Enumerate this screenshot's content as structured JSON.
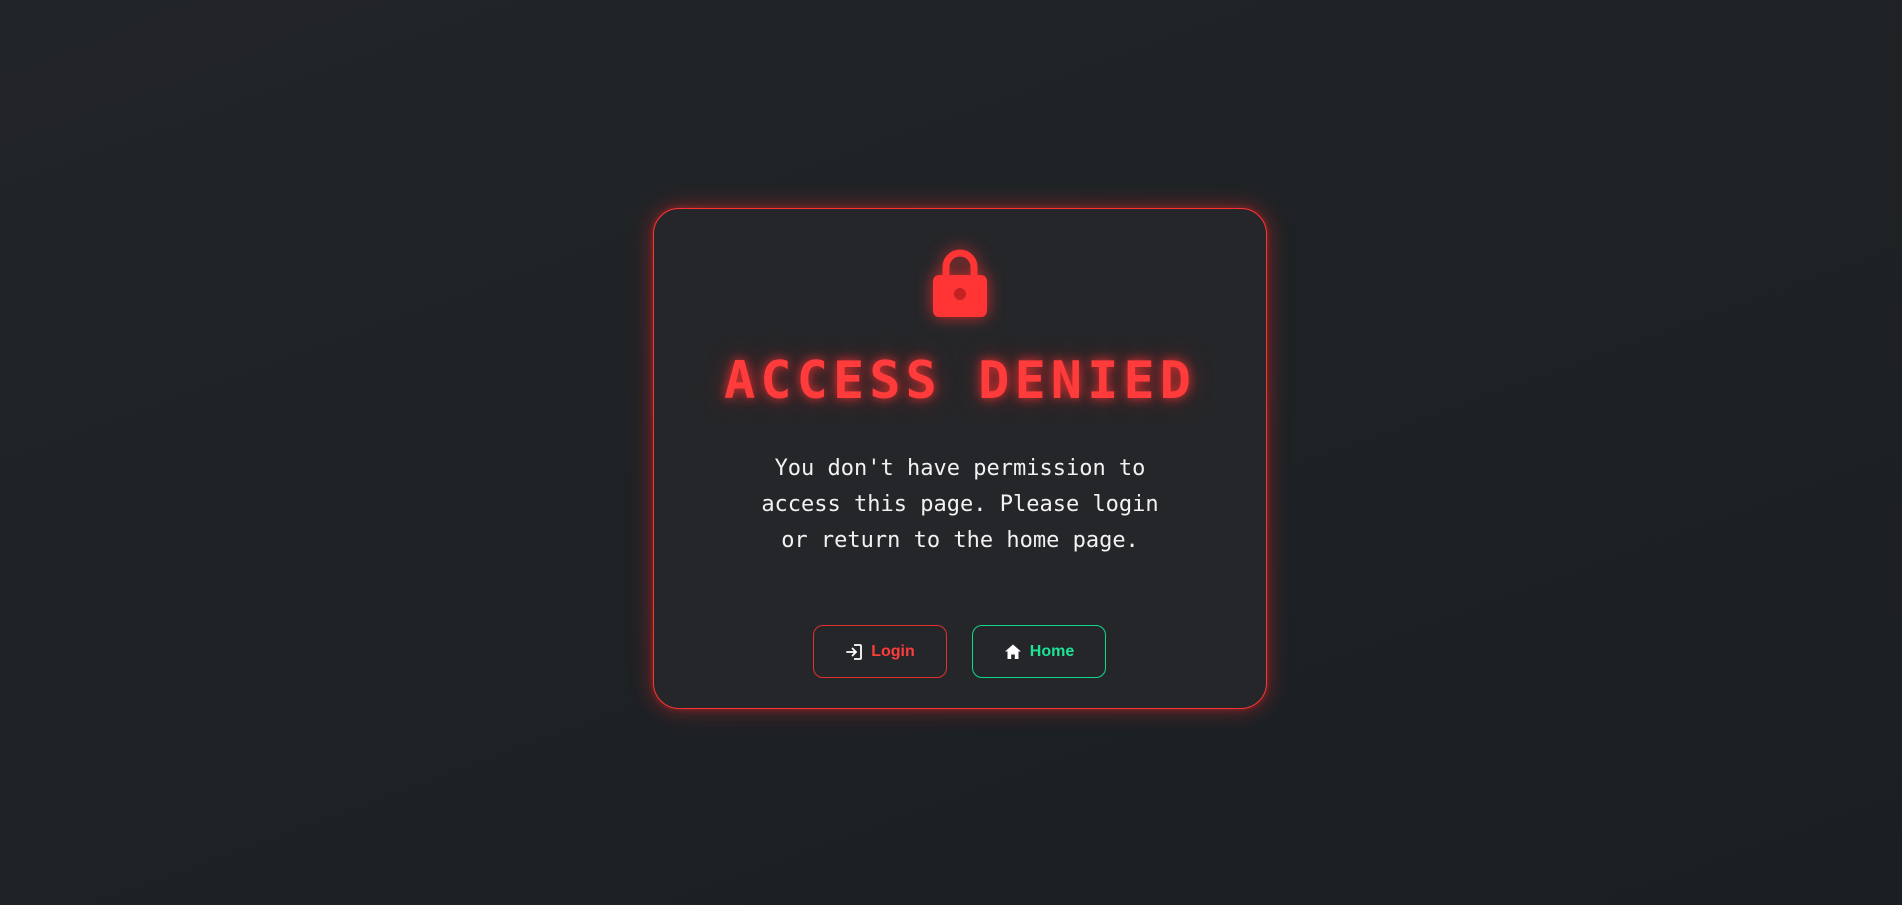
{
  "card": {
    "icon": "lock-icon",
    "title": "ACCESS DENIED",
    "message": "You don't have permission to access this page. Please login or return to the home page."
  },
  "buttons": {
    "login": {
      "label": "Login",
      "icon": "login-icon"
    },
    "home": {
      "label": "Home",
      "icon": "home-icon"
    }
  },
  "colors": {
    "accent_red": "#ff3b3b",
    "accent_green": "#1de394",
    "card_bg": "#252629",
    "page_bg": "#1e2225",
    "text": "#f2f2f2"
  }
}
